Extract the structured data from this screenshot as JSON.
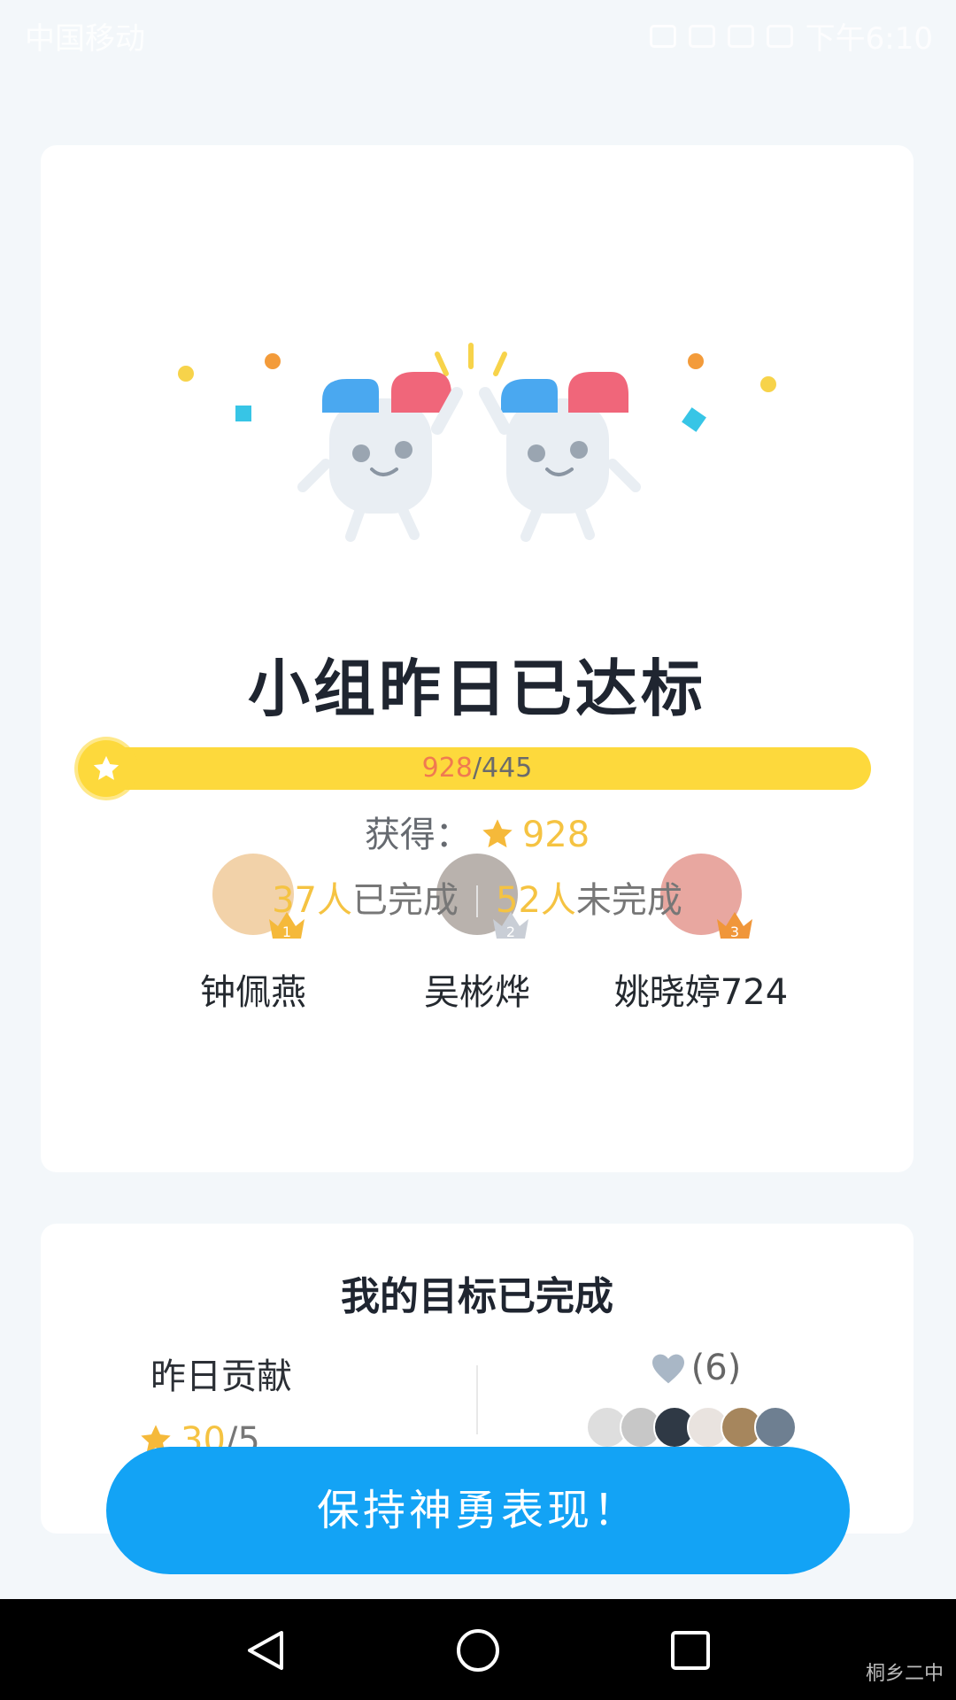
{
  "status_bar": {
    "carrier": "中国移动",
    "time": "下午6:10"
  },
  "colors": {
    "accent_blue": "#13a3f5",
    "star_yellow": "#f5c342",
    "progress_yellow": "#fdd93c",
    "current_red": "#f07a50"
  },
  "main_card": {
    "title": "小组昨日已达标",
    "earned_label": "获得：",
    "earned_value": "928",
    "progress": {
      "current": "928",
      "separator": "/",
      "target": "445",
      "fraction": 1.0
    },
    "ranking": [
      {
        "rank": "1",
        "name": "钟佩燕",
        "avatar_color": "#f2d2a9"
      },
      {
        "rank": "2",
        "name": "吴彬烨",
        "avatar_color": "#b9b2ad"
      },
      {
        "rank": "3",
        "name": "姚晓婷724",
        "avatar_color": "#e8a7a0"
      }
    ],
    "stats": {
      "completed_count": "37人",
      "completed_label": "已完成",
      "incomplete_count": "52人",
      "incomplete_label": "未完成"
    }
  },
  "my_goal_card": {
    "heading": "我的目标已完成",
    "contribution_label": "昨日贡献",
    "contribution_value": "30",
    "contribution_separator": "/",
    "contribution_target": "5",
    "likes": "(6)",
    "liker_avatar_colors": [
      "#dedede",
      "#c7c7c7",
      "#2f3945",
      "#e9e3df",
      "#a6865d",
      "#6e7f91"
    ]
  },
  "cta_button": {
    "label": "保持神勇表现！"
  },
  "watermark": "桐乡二中"
}
